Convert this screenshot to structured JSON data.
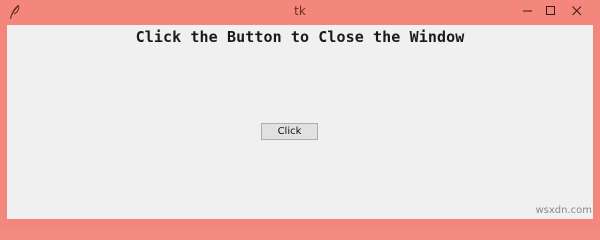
{
  "window": {
    "title": "tk",
    "controls": {
      "minimize": "minimize-icon",
      "maximize": "maximize-icon",
      "close": "close-icon"
    },
    "frame_color": "#f4877b"
  },
  "content": {
    "heading": "Click the Button to Close the Window",
    "button_label": "Click"
  },
  "watermark": "wsxdn.com"
}
